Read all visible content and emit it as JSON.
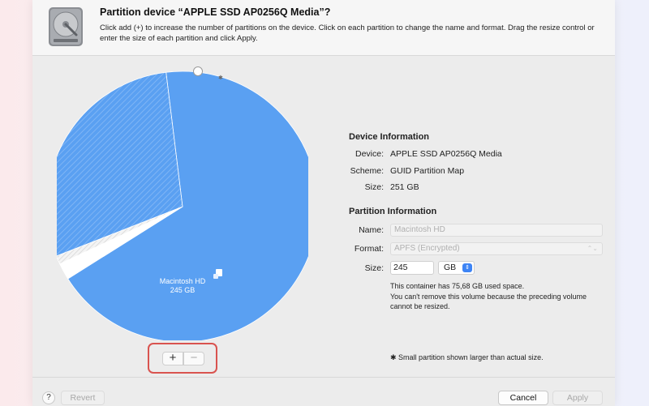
{
  "header": {
    "title": "Partition device “APPLE SSD AP0256Q Media”?",
    "instructions": "Click add (+) to increase the number of partitions on the device. Click on each partition to change the name and format. Drag the resize control or enter the size of each partition and click Apply.",
    "icon": "hard-disk-icon"
  },
  "chart_data": {
    "type": "pie",
    "slices": [
      {
        "label": "Macintosh HD",
        "size_label": "245 GB",
        "value": 0.68,
        "color": "#5aa0f2",
        "style": "solid"
      },
      {
        "label": "",
        "size_label": "",
        "value": 0.02,
        "color": "#ffffff",
        "style": "solid"
      },
      {
        "label": "",
        "size_label": "",
        "value": 0.01,
        "color": "#f0f0f0",
        "style": "hatched"
      },
      {
        "label": "",
        "size_label": "",
        "value": 0.29,
        "color": "#5aa0f2",
        "style": "hatched"
      }
    ]
  },
  "pie_controls": {
    "add_label": "+",
    "remove_label": "−",
    "highlight_color": "#d9534f"
  },
  "device_info": {
    "heading": "Device Information",
    "device_label": "Device:",
    "device_value": "APPLE SSD AP0256Q Media",
    "scheme_label": "Scheme:",
    "scheme_value": "GUID Partition Map",
    "size_label": "Size:",
    "size_value": "251 GB"
  },
  "partition_info": {
    "heading": "Partition Information",
    "name_label": "Name:",
    "name_value": "Macintosh HD",
    "format_label": "Format:",
    "format_value": "APFS (Encrypted)",
    "size_label": "Size:",
    "size_value": "245",
    "size_unit": "GB",
    "note_line1": "This container has 75,68 GB used space.",
    "note_line2": "You can't remove this volume because the preceding volume cannot be resized."
  },
  "footnote": "✱ Small partition shown larger than actual size.",
  "footer": {
    "help_label": "?",
    "revert_label": "Revert",
    "cancel_label": "Cancel",
    "apply_label": "Apply"
  },
  "colors": {
    "accent": "#3d84f5",
    "pie_blue": "#5aa0f2"
  }
}
